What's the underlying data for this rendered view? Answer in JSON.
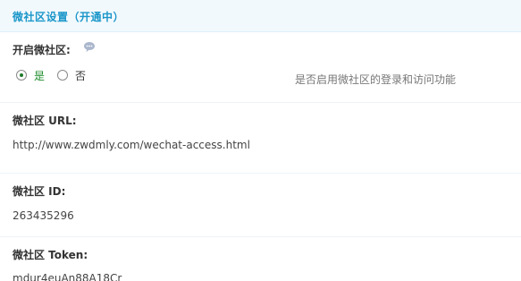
{
  "header": {
    "title": "微社区设置（开通中）"
  },
  "enable": {
    "label": "开启微社区:",
    "help_icon": "help-bubble-icon",
    "options": [
      {
        "label": "是",
        "selected": true
      },
      {
        "label": "否",
        "selected": false
      }
    ],
    "hint": "是否启用微社区的登录和访问功能"
  },
  "url": {
    "label": "微社区 URL:",
    "value": "http://www.zwdmly.com/wechat-access.html"
  },
  "id": {
    "label": "微社区 ID:",
    "value": "263435296"
  },
  "token": {
    "label": "微社区 Token:",
    "value": "mdur4euAn88A18Cr"
  },
  "colors": {
    "header_bg": "#f2f9fd",
    "header_text": "#1a96c9",
    "selected_option": "#1e8c2c"
  }
}
